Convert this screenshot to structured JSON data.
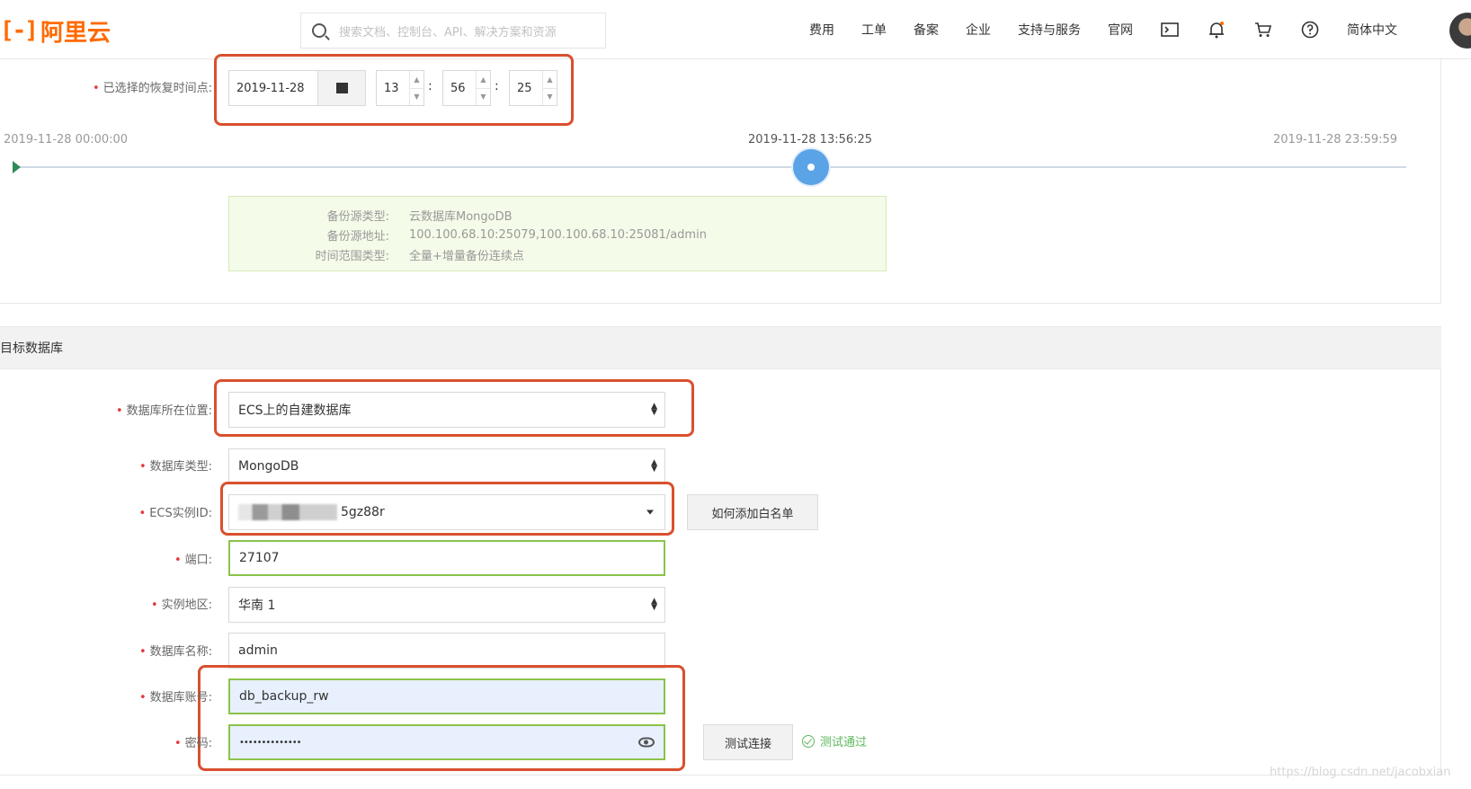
{
  "header": {
    "logo_mark": "[-]",
    "logo_text": "阿里云",
    "search_placeholder": "搜索文档、控制台、API、解决方案和资源",
    "nav": [
      "费用",
      "工单",
      "备案",
      "企业",
      "支持与服务",
      "官网"
    ],
    "icons": [
      "terminal-icon",
      "bell-icon",
      "cart-icon",
      "help-icon"
    ],
    "language": "简体中文"
  },
  "restore_time": {
    "label": "已选择的恢复时间点:",
    "date": "2019-11-28",
    "hour": "13",
    "minute": "56",
    "second": "25"
  },
  "timeline": {
    "start": "2019-11-28 00:00:00",
    "current": "2019-11-28 13:56:25",
    "end": "2019-11-28 23:59:59",
    "position_fraction": 0.58
  },
  "source_info": [
    {
      "key": "备份源类型:",
      "value": "云数据库MongoDB"
    },
    {
      "key": "备份源地址:",
      "value": "100.100.68.10:25079,100.100.68.10:25081/admin"
    },
    {
      "key": "时间范围类型:",
      "value": "全量+增量备份连续点"
    }
  ],
  "target": {
    "section_title": "目标数据库",
    "db_location_label": "数据库所在位置:",
    "db_location_value": "ECS上的自建数据库",
    "db_type_label": "数据库类型:",
    "db_type_value": "MongoDB",
    "ecs_label": "ECS实例ID:",
    "ecs_value_suffix": "5gz88r",
    "whitelist_button": "如何添加白名单",
    "port_label": "端口:",
    "port_value": "27107",
    "region_label": "实例地区:",
    "region_value": "华南 1",
    "db_name_label": "数据库名称:",
    "db_name_value": "admin",
    "account_label": "数据库账号:",
    "account_value": "db_backup_rw",
    "password_label": "密码:",
    "password_value": "••••••••••••••",
    "test_button": "测试连接",
    "test_result": "测试通过"
  },
  "watermark": "https://blog.csdn.net/jacobxian",
  "colors": {
    "brand": "#ff6a00",
    "highlight_border": "#d9502f",
    "valid_border": "#8bc34a",
    "knob": "#5aa3e6",
    "success": "#5cb85c"
  }
}
